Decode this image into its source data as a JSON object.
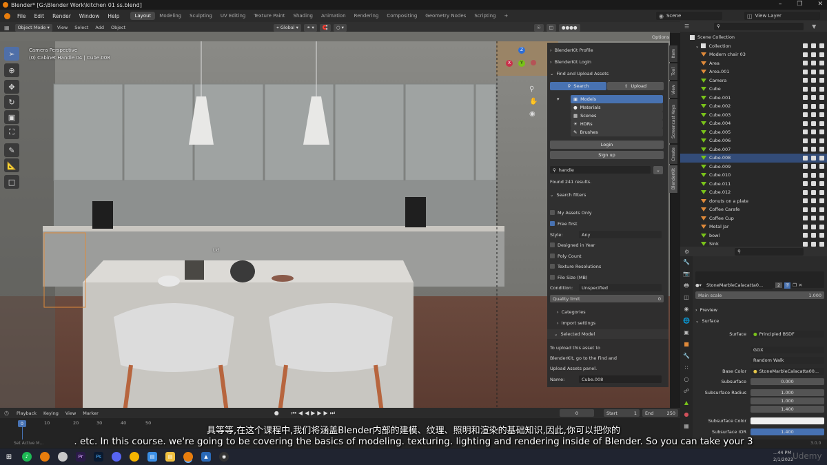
{
  "window": {
    "title": "Blender* [G:\\Blender Work\\kitchen 01 ss.blend]"
  },
  "menu": {
    "items": [
      "File",
      "Edit",
      "Render",
      "Window",
      "Help"
    ]
  },
  "workspaces": {
    "tabs": [
      "Layout",
      "Modeling",
      "Sculpting",
      "UV Editing",
      "Texture Paint",
      "Shading",
      "Animation",
      "Rendering",
      "Compositing",
      "Geometry Nodes",
      "Scripting"
    ],
    "active": "Layout",
    "plus": "+"
  },
  "scene": {
    "label": "Scene",
    "view_layer": "View Layer"
  },
  "viewport_header": {
    "mode": "Object Mode",
    "view": "View",
    "select": "Select",
    "add": "Add",
    "object": "Object",
    "orientation": "Global",
    "search_value": "handle",
    "options": "Options"
  },
  "viewport": {
    "camera_label": "Camera Perspective",
    "object_label": "(0) Cabinet Handle 04 | Cube.008",
    "lid_label": "Lid",
    "accent": "#e08a3a"
  },
  "gizmo": {
    "x": "X",
    "y": "Y",
    "z": "Z"
  },
  "blenderkit": {
    "profile": "BlenderKit Profile",
    "login_header": "BlenderKit Login",
    "find_upload": "Find and Upload Assets",
    "search_tab": "Search",
    "upload_tab": "Upload",
    "categories": [
      "Models",
      "Materials",
      "Scenes",
      "HDRs",
      "Brushes"
    ],
    "login_btn": "Login",
    "signup_btn": "Sign up",
    "search_value": "handle",
    "found": "Found 241 results.",
    "search_filters": "Search filters",
    "my_assets_only": "My Assets Only",
    "free_first": "Free first",
    "style_label": "Style:",
    "style_value": "Any",
    "designed_in_year": "Designed in Year",
    "poly_count": "Poly Count",
    "texture_resolutions": "Texture Resolutions",
    "file_size": "File Size (MB)",
    "condition_label": "Condition:",
    "condition_value": "Unspecified",
    "quality_limit": "Quality limit",
    "quality_value": "0",
    "categories_label": "Categories",
    "import_settings": "Import settings",
    "selected_model": "Selected Model",
    "upload_text": [
      "To upload this asset to",
      "BlenderKit, go to the Find and",
      "Upload Assets panel."
    ],
    "name_label": "Name:",
    "name_value": "Cube.008"
  },
  "sidebar_tabs": [
    "Item",
    "Tool",
    "View",
    "Screencast Keys",
    "Create",
    "BlenderKit"
  ],
  "outliner": {
    "search_placeholder": "",
    "scene_collection": "Scene Collection",
    "collection": "Collection",
    "items": [
      {
        "name": "Modern chair 03",
        "icon": "empty",
        "selected": false
      },
      {
        "name": "Area",
        "icon": "light",
        "selected": false
      },
      {
        "name": "Area.001",
        "icon": "light",
        "selected": false
      },
      {
        "name": "Camera",
        "icon": "camera",
        "selected": false
      },
      {
        "name": "Cube",
        "icon": "mesh",
        "selected": false
      },
      {
        "name": "Cube.001",
        "icon": "mesh",
        "selected": false
      },
      {
        "name": "Cube.002",
        "icon": "mesh",
        "selected": false
      },
      {
        "name": "Cube.003",
        "icon": "mesh",
        "selected": false
      },
      {
        "name": "Cube.004",
        "icon": "mesh",
        "selected": false
      },
      {
        "name": "Cube.005",
        "icon": "mesh",
        "selected": false
      },
      {
        "name": "Cube.006",
        "icon": "mesh",
        "selected": false
      },
      {
        "name": "Cube.007",
        "icon": "mesh",
        "selected": false
      },
      {
        "name": "Cube.008",
        "icon": "mesh",
        "selected": true
      },
      {
        "name": "Cube.009",
        "icon": "mesh",
        "selected": false
      },
      {
        "name": "Cube.010",
        "icon": "mesh",
        "selected": false
      },
      {
        "name": "Cube.011",
        "icon": "mesh",
        "selected": false
      },
      {
        "name": "Cube.012",
        "icon": "mesh",
        "selected": false
      },
      {
        "name": "donuts on a plate",
        "icon": "empty",
        "selected": false
      },
      {
        "name": "Coffee Carafe",
        "icon": "empty",
        "selected": false
      },
      {
        "name": "Coffee Cup",
        "icon": "empty",
        "selected": false
      },
      {
        "name": "Metal Jar",
        "icon": "empty",
        "selected": false
      },
      {
        "name": "bowl",
        "icon": "mesh",
        "selected": false
      },
      {
        "name": "Sink",
        "icon": "mesh",
        "selected": false
      }
    ]
  },
  "properties": {
    "material_name": "StoneMarbleCalacatta0...",
    "user_count": "2",
    "main_scale_label": "Main scale",
    "main_scale_value": "1.000",
    "preview": "Preview",
    "surface_section": "Surface",
    "surface_label": "Surface",
    "surface_value": "Principled BSDF",
    "distribution": "GGX",
    "subsurface_method": "Random Walk",
    "base_color_label": "Base Color",
    "base_color_value": "StoneMarbleCalacatta00...",
    "subsurface_label": "Subsurface",
    "subsurface_value": "0.000",
    "subsurface_radius_label": "Subsurface Radius",
    "radius_values": [
      "1.000",
      "1.000",
      "1.400"
    ],
    "subsurface_color_label": "Subsurface Color",
    "subsurface_ior_label": "Subsurface IOR",
    "subsurface_ior_value": "1.400"
  },
  "timeline": {
    "playback": "Playback",
    "keying": "Keying",
    "view": "View",
    "marker": "Marker",
    "current_frame": "0",
    "start_label": "Start",
    "start_value": "1",
    "end_label": "End",
    "end_value": "250",
    "ticks": [
      "0",
      "10",
      "20",
      "30",
      "40",
      "50"
    ]
  },
  "status": {
    "left": "Set Active M...",
    "version": "3.0.0"
  },
  "taskbar": {
    "time": "...44 PM",
    "date": "2/1/2022",
    "watermark": "Udemy"
  },
  "subtitles": {
    "zh": "具等等,在这个课程中,我们将涵盖Blender内部的建模、纹理、照明和渲染的基础知识,因此,你可以把你的",
    "en": ". etc. In this course. we're going to be covering the basics of modeling. texturing. lighting and rendering inside of Blender. So you can take your 3"
  }
}
